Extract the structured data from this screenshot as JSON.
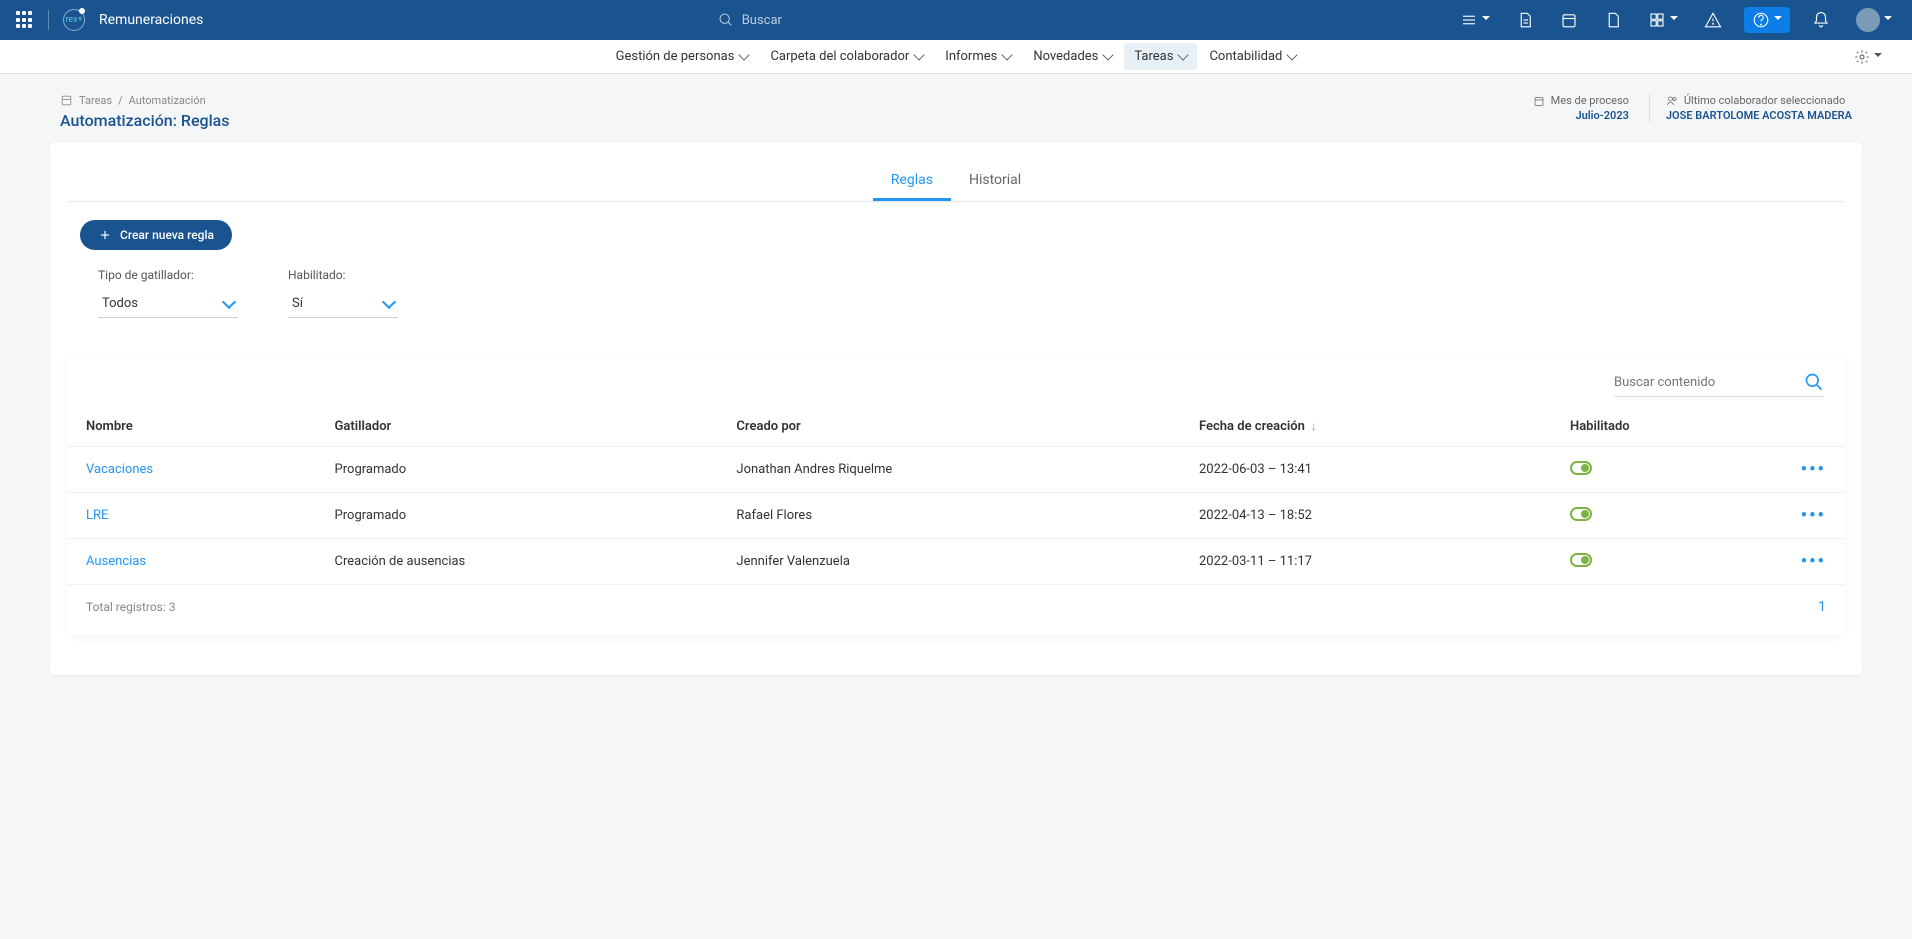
{
  "top_bar": {
    "app_name": "Remuneraciones",
    "search_placeholder": "Buscar"
  },
  "sub_nav": [
    {
      "label": "Gestión de personas",
      "active": false
    },
    {
      "label": "Carpeta del colaborador",
      "active": false
    },
    {
      "label": "Informes",
      "active": false
    },
    {
      "label": "Novedades",
      "active": false
    },
    {
      "label": "Tareas",
      "active": true
    },
    {
      "label": "Contabilidad",
      "active": false
    }
  ],
  "breadcrumb": {
    "parent": "Tareas",
    "current": "Automatización"
  },
  "page_title": "Automatización: Reglas",
  "header_meta": {
    "month_label": "Mes de proceso",
    "month_value": "Julio-2023",
    "collab_label": "Último colaborador seleccionado",
    "collab_value": "JOSE BARTOLOME ACOSTA MADERA"
  },
  "tabs": [
    {
      "label": "Reglas",
      "active": true
    },
    {
      "label": "Historial",
      "active": false
    }
  ],
  "create_button": "Crear nueva regla",
  "filters": {
    "trigger_label": "Tipo de gatillador:",
    "trigger_value": "Todos",
    "enabled_label": "Habilitado:",
    "enabled_value": "Sí"
  },
  "table": {
    "search_placeholder": "Buscar contenido",
    "columns": [
      "Nombre",
      "Gatillador",
      "Creado por",
      "Fecha de creación",
      "Habilitado",
      ""
    ],
    "rows": [
      {
        "name": "Vacaciones",
        "trigger": "Programado",
        "creator": "Jonathan Andres Riquelme",
        "date": "2022-06-03 – 13:41",
        "enabled": true
      },
      {
        "name": "LRE",
        "trigger": "Programado",
        "creator": "Rafael Flores",
        "date": "2022-04-13 – 18:52",
        "enabled": true
      },
      {
        "name": "Ausencias",
        "trigger": "Creación de ausencias",
        "creator": "Jennifer Valenzuela",
        "date": "2022-03-11 – 11:17",
        "enabled": true
      }
    ],
    "total_label": "Total registros:",
    "total_count": "3",
    "page": "1"
  }
}
